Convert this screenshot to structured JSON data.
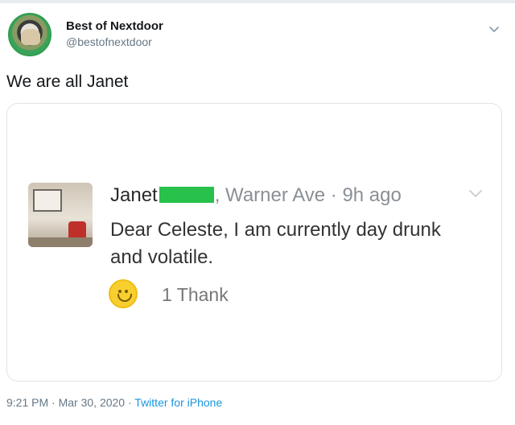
{
  "tweet": {
    "display_name": "Best of Nextdoor",
    "handle": "@bestofnextdoor",
    "text": "We are all Janet",
    "time": "9:21 PM",
    "separator": "·",
    "date": "Mar 30, 2020",
    "source": "Twitter for iPhone",
    "icons": {
      "avatar": "profile-photo",
      "menu": "chevron-down-icon"
    }
  },
  "quoted": {
    "name": "Janet",
    "location": ", Warner Ave · 9h ago",
    "body": "Dear Celeste, I am currently day drunk and volatile.",
    "reaction_count": "1 Thank",
    "redaction_color": "#27c14b",
    "icons": {
      "menu": "chevron-down-icon",
      "reaction": "smiley-icon"
    }
  },
  "colors": {
    "link": "#1b95e0",
    "meta": "#657786"
  }
}
